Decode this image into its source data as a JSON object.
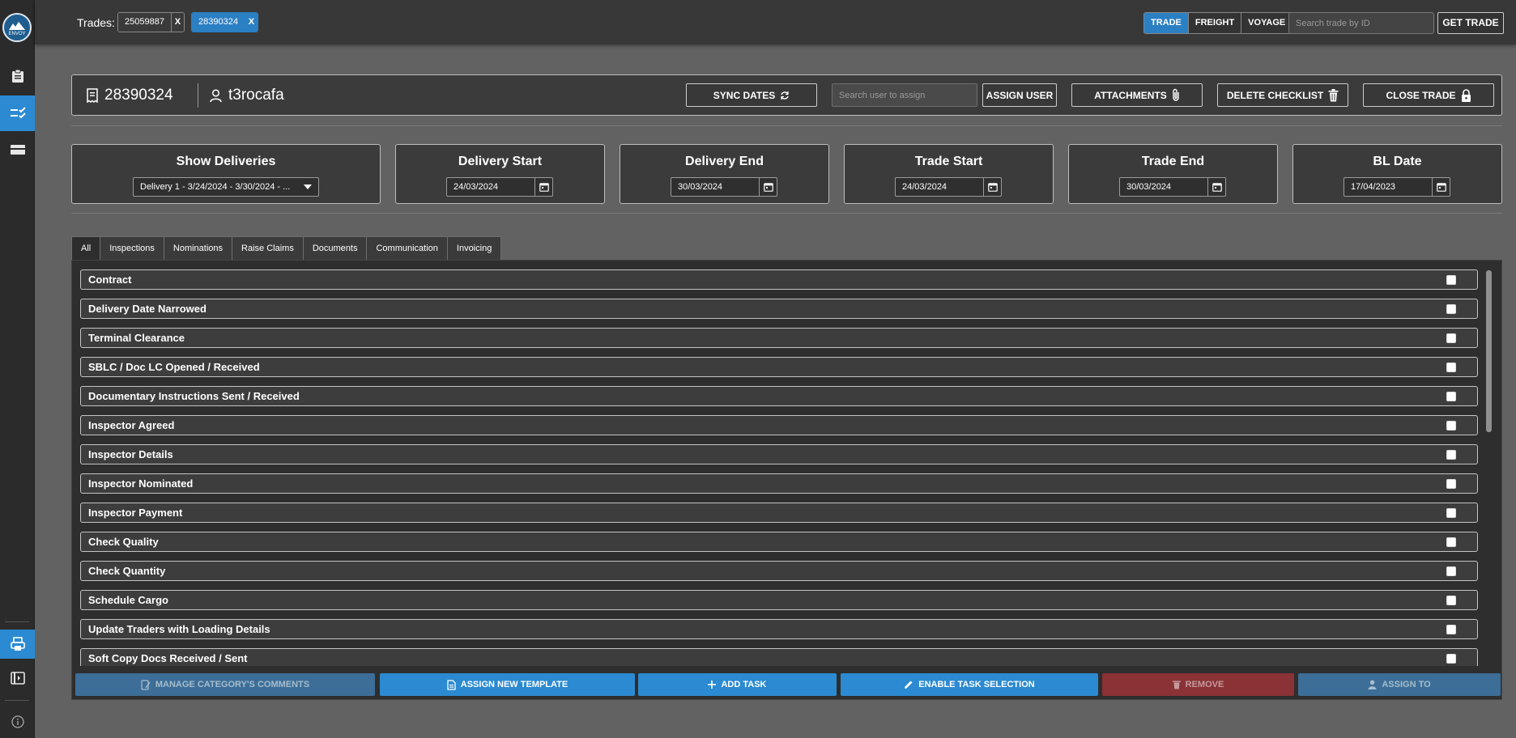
{
  "sidebar": {
    "logo_text": "ENVOY",
    "items": [
      {
        "name": "clipboard-icon",
        "active": false
      },
      {
        "name": "checklist-icon",
        "active": true
      },
      {
        "name": "card-icon",
        "active": false
      }
    ],
    "bottom_items": [
      {
        "name": "printer-icon",
        "active": true
      },
      {
        "name": "collapse-panel-icon",
        "active": false
      },
      {
        "name": "info-icon",
        "active": false
      }
    ]
  },
  "topbar": {
    "trades_label": "Trades:",
    "trade_chips": [
      {
        "id": "25059887",
        "close": "X",
        "active": false
      },
      {
        "id": "28390324",
        "close": "X",
        "active": true
      }
    ],
    "modes": [
      "TRADE",
      "FREIGHT",
      "VOYAGE"
    ],
    "active_mode": "TRADE",
    "search_placeholder": "Search trade by ID",
    "get_trade_label": "GET TRADE"
  },
  "header": {
    "trade_id": "28390324",
    "user": "t3rocafa",
    "sync_dates_label": "SYNC DATES",
    "assign_search_placeholder": "Search user to assign",
    "assign_user_label": "ASSIGN USER",
    "attachments_label": "ATTACHMENTS",
    "delete_checklist_label": "DELETE CHECKLIST",
    "close_trade_label": "CLOSE TRADE"
  },
  "dates": {
    "show_deliveries": {
      "title": "Show Deliveries",
      "value": "Delivery 1 - 3/24/2024 - 3/30/2024 - ..."
    },
    "delivery_start": {
      "title": "Delivery Start",
      "value": "24/03/2024"
    },
    "delivery_end": {
      "title": "Delivery End",
      "value": "30/03/2024"
    },
    "trade_start": {
      "title": "Trade Start",
      "value": "24/03/2024"
    },
    "trade_end": {
      "title": "Trade End",
      "value": "30/03/2024"
    },
    "bl_date": {
      "title": "BL Date",
      "value": "17/04/2023"
    }
  },
  "tabs": [
    "All",
    "Inspections",
    "Nominations",
    "Raise Claims",
    "Documents",
    "Communication",
    "Invoicing"
  ],
  "active_tab": "All",
  "tasks": [
    "Contract",
    "Delivery Date Narrowed",
    "Terminal Clearance",
    "SBLC / Doc LC Opened / Received",
    "Documentary Instructions Sent / Received",
    "Inspector Agreed",
    "Inspector Details",
    "Inspector Nominated",
    "Inspector Payment",
    "Check Quality",
    "Check Quantity",
    "Schedule Cargo",
    "Update Traders with Loading Details",
    "Soft Copy Docs Received / Sent"
  ],
  "actions": {
    "manage_comments": "MANAGE CATEGORY'S COMMENTS",
    "assign_template": "ASSIGN NEW TEMPLATE",
    "add_task": "ADD TASK",
    "enable_selection": "ENABLE TASK SELECTION",
    "remove": "REMOVE",
    "assign_to": "ASSIGN TO"
  },
  "colors": {
    "accent": "#2b8ad1",
    "background": "#626262",
    "panel": "#3b3b3b",
    "danger": "#8a3236"
  }
}
